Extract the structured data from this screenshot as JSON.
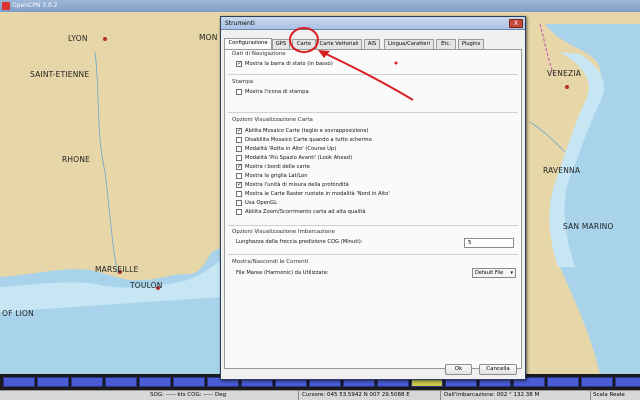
{
  "app": {
    "title": "OpenCPN 3.0.2"
  },
  "chart": {
    "places": [
      "LYON",
      "SAINT-ETIENNE",
      "RHONE",
      "MARSEILLE",
      "TOULON",
      "OF LION",
      "MON",
      "VENEZIA",
      "RAVENNA",
      "SAN MARINO"
    ],
    "colors": {
      "land": "#e6d6a8",
      "sea": "#a9d3ea",
      "sea_shallow": "#c7e6f4",
      "border": "#c050b0"
    }
  },
  "dialog": {
    "title": "Strumenti",
    "close_label": "X",
    "tabs": [
      {
        "label": "Configurazione"
      },
      {
        "label": "GPS"
      },
      {
        "label": "Carte"
      },
      {
        "label": "Carte Vettoriali"
      },
      {
        "label": "AIS"
      },
      {
        "label": "Lingua/Caratteri"
      },
      {
        "label": "Etc."
      },
      {
        "label": "Plugins"
      }
    ],
    "active_tab": "Configurazione",
    "groups": {
      "nav": {
        "title": "Dati di Navigazione",
        "items": [
          {
            "label": "Mostra la barra di stato (in basso)",
            "checked": true
          }
        ]
      },
      "print": {
        "title": "Stampa",
        "items": [
          {
            "label": "Mostra l'icona di stampa",
            "checked": false
          }
        ]
      },
      "display": {
        "title": "Opzioni Visualizzazione Carta",
        "items": [
          {
            "label": "Abilita Mosaico Carte (taglio e sovrapposizione)",
            "checked": true
          },
          {
            "label": "Disabilita Mosaico Carte quando a tutto schermo",
            "checked": false
          },
          {
            "label": "Modalità 'Rotta in Alto' (Course Up)",
            "checked": false
          },
          {
            "label": "Modalità 'Più Spazio Avanti' (Look Ahead)",
            "checked": false
          },
          {
            "label": "Mostra i bordi delle carte",
            "checked": true
          },
          {
            "label": "Mostra la griglia Lat/Lon",
            "checked": false
          },
          {
            "label": "Mostra l'unità di misura della profondità",
            "checked": true
          },
          {
            "label": "Mostra le Carte Raster ruotate in modalità 'Nord in Alto'",
            "checked": false
          },
          {
            "label": "Usa OpenGL",
            "checked": false
          },
          {
            "label": "Abilita Zoom/Scorrimento carta ad alta qualità",
            "checked": false
          }
        ]
      },
      "ownship": {
        "title": "Opzioni Visualizzazione Imbarcazione",
        "cog_label": "Lunghezza della freccia predizione COG (Minuti):",
        "cog_value": "5"
      },
      "currents": {
        "title": "Mostra/Nascondi le Correnti",
        "tide_label": "File Maree (Harmonic) da Utilizzare:",
        "tide_value": "Default File"
      }
    },
    "ok_label": "Ok",
    "cancel_label": "Cancella"
  },
  "statusbar": {
    "sog": "SOG: ----- kts  COG: ----- Deg",
    "cursor": "Cursore: 045 53.5942 N 007 29.5088 E",
    "from_boat": "Dall'imbarcazione: 002 ° 132.38 M",
    "scale": "Scala Reale"
  },
  "quilt": {
    "tiles_count": 20,
    "tile_color": "#4a5bd4",
    "highlight_color": "#c9c94a"
  },
  "annotation": {
    "color": "#d81e1e"
  }
}
